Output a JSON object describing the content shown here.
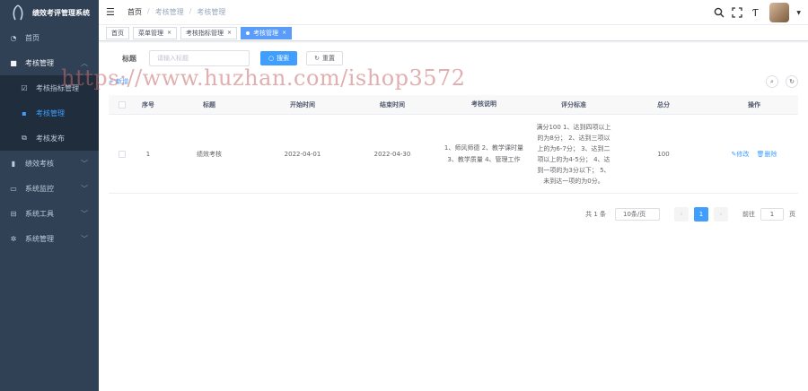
{
  "app": {
    "title": "绩效考评管理系统"
  },
  "sidebar": {
    "items": [
      {
        "label": "首页",
        "icon": "dashboard-icon"
      },
      {
        "label": "考核管理",
        "icon": "folder-icon"
      },
      {
        "label": "绩效考核",
        "icon": "bar-chart-icon"
      },
      {
        "label": "系统监控",
        "icon": "monitor-icon"
      },
      {
        "label": "系统工具",
        "icon": "toolbox-icon"
      },
      {
        "label": "系统管理",
        "icon": "gear-icon"
      }
    ],
    "submenu": [
      {
        "label": "考核指标管理",
        "icon": "checkbox-icon"
      },
      {
        "label": "考核管理",
        "icon": "list-icon"
      },
      {
        "label": "考核发布",
        "icon": "external-link-icon"
      }
    ]
  },
  "breadcrumb": [
    "首页",
    "考核管理",
    "考核管理"
  ],
  "tags": [
    {
      "label": "首页"
    },
    {
      "label": "菜单管理"
    },
    {
      "label": "考核指标管理"
    },
    {
      "label": "考核管理"
    }
  ],
  "search": {
    "label": "标题",
    "placeholder": "请输入标题",
    "search_btn": "搜索",
    "reset_btn": "重置"
  },
  "toolbar": {
    "add": "新增"
  },
  "watermark": "https://www.huzhan.com/ishop3572",
  "table": {
    "headers": [
      "序号",
      "标题",
      "开始时间",
      "结束时间",
      "考核说明",
      "评分标准",
      "总分",
      "操作"
    ],
    "rows": [
      {
        "no": "1",
        "title": "绩效考核",
        "start": "2022-04-01",
        "end": "2022-04-30",
        "desc": "1、师风师德 2、教学课时量 3、教学质量 4、管理工作",
        "std": "满分100 1、达到四项以上的为8分； 2、达到三项以上的为6-7分； 3、达到二项以上的为4-5分； 4、达到一项的为3分以下； 5、未到达一项的为0分。",
        "total": "100",
        "edit": "修改",
        "delete": "删除"
      }
    ]
  },
  "pagination": {
    "total": "共 1 条",
    "size": "10条/页",
    "current": "1",
    "goto": "前往",
    "goto_value": "1",
    "page_suffix": "页"
  },
  "colors": {
    "sidebar_bg": "#304156",
    "primary": "#409eff"
  }
}
